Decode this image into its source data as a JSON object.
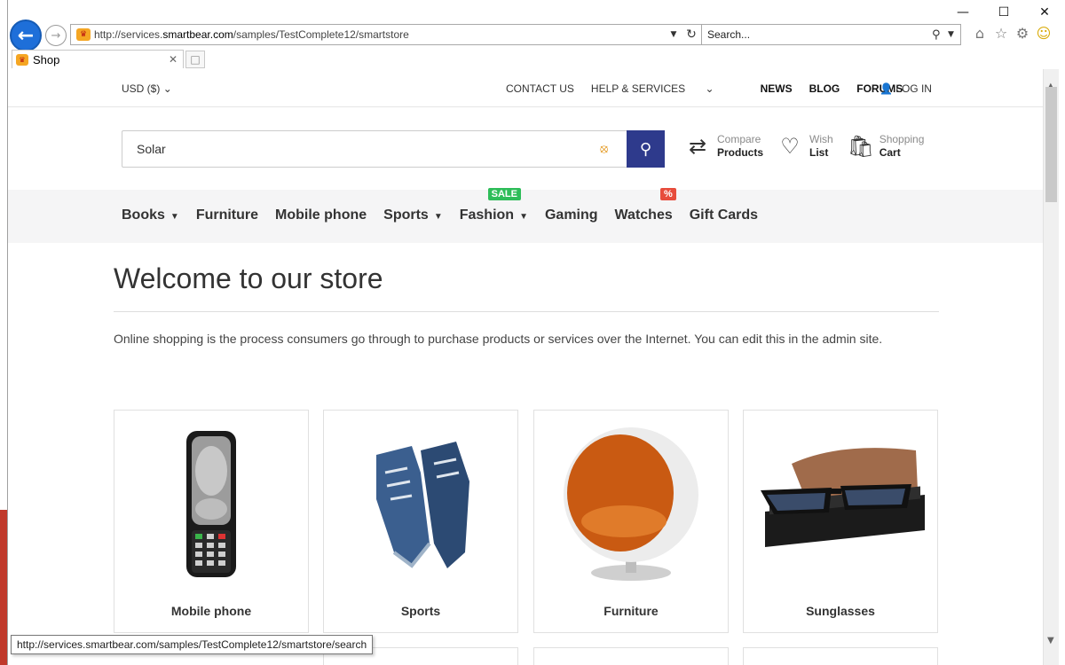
{
  "browser": {
    "url_prefix": "http://services.",
    "url_domain": "smartbear.com",
    "url_path": "/samples/TestComplete12/smartstore",
    "search_placeholder": "Search...",
    "tab_title": "Shop",
    "status_url": "http://services.smartbear.com/samples/TestComplete12/smartstore/search"
  },
  "topbar": {
    "currency": "USD ($)",
    "contact": "CONTACT US",
    "help": "HELP & SERVICES",
    "news": "NEWS",
    "blog": "BLOG",
    "forums": "FORUMS",
    "login": "LOG IN"
  },
  "search": {
    "value": "Solar"
  },
  "header_tools": [
    {
      "l1": "Compare",
      "l2": "Products",
      "icon": "compare-icon"
    },
    {
      "l1": "Wish",
      "l2": "List",
      "icon": "heart-icon"
    },
    {
      "l1": "Shopping",
      "l2": "Cart",
      "icon": "shopping-bag-icon"
    }
  ],
  "menu": {
    "books": "Books",
    "furniture": "Furniture",
    "mobile": "Mobile phone",
    "sports": "Sports",
    "fashion": "Fashion",
    "gaming": "Gaming",
    "watches": "Watches",
    "giftcards": "Gift Cards",
    "sale_badge": "SALE",
    "pct_badge": "%"
  },
  "content": {
    "title": "Welcome to our store",
    "text": "Online shopping is the process consumers go through to purchase products or services over the Internet. You can edit this in the admin site."
  },
  "categories": [
    "Mobile phone",
    "Sports",
    "Furniture",
    "Sunglasses"
  ],
  "colors": {
    "accent": "#2e3a8c",
    "sale": "#2ebd59",
    "discount": "#e74c3c"
  }
}
